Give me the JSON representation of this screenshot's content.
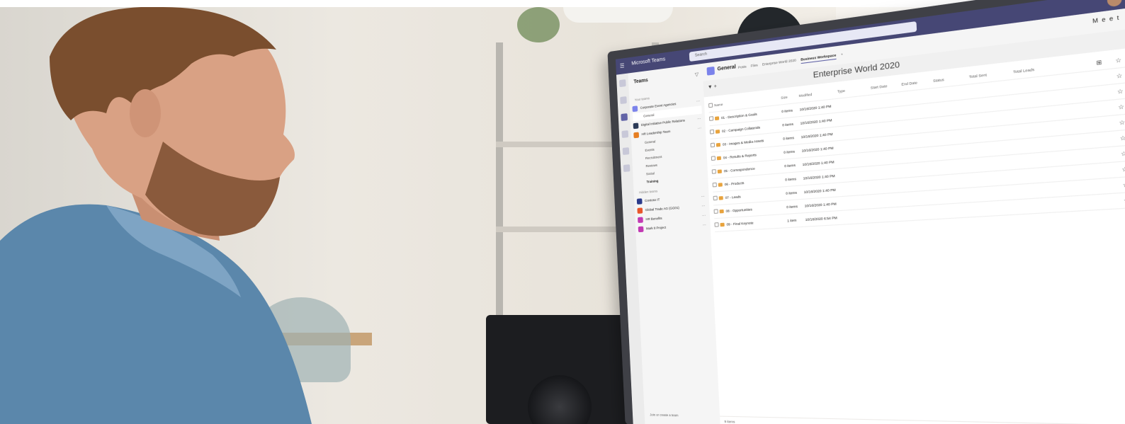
{
  "teams_app": {
    "title": "Microsoft Teams",
    "search_placeholder": "Search",
    "meet_button": "Meet",
    "teams_pane": {
      "title": "Teams",
      "your_teams_label": "Your teams",
      "hidden_teams_label": "Hidden teams",
      "teams": [
        {
          "name": "Corporate Event Agencies",
          "color": "#7b83eb",
          "channels": [
            {
              "name": "General",
              "selected": true
            }
          ]
        },
        {
          "name": "Digital Initiative Public Relations",
          "color": "#2b3a57",
          "channels": []
        },
        {
          "name": "HR Leadership Team",
          "color": "#e67e22",
          "channels": [
            {
              "name": "General"
            },
            {
              "name": "Events"
            },
            {
              "name": "Recruitment"
            },
            {
              "name": "Reviews"
            },
            {
              "name": "Social"
            },
            {
              "name": "Training",
              "bold": true
            }
          ]
        }
      ],
      "hidden_teams": [
        {
          "name": "Contoso IT",
          "color": "#2b3a8a"
        },
        {
          "name": "Global Trade AG (GG01)",
          "color": "#e8552b"
        },
        {
          "name": "HR Benefits",
          "color": "#c239b3"
        },
        {
          "name": "Mark 8 Project",
          "color": "#c239b3"
        }
      ],
      "join_link": "Join or create a team"
    },
    "channel": {
      "name": "General",
      "tabs": [
        "Posts",
        "Files",
        "Enterprise World 2020",
        "Business Workspace"
      ],
      "active_tab": "Business Workspace"
    },
    "list": {
      "title": "Enterprise World 2020",
      "columns": [
        "Name",
        "Size",
        "Modified",
        "Type",
        "Start Date",
        "End Date",
        "Status",
        "Total Sent",
        "Total Leads"
      ],
      "rows": [
        {
          "name": "01 - Description & Goals",
          "size": "0 items",
          "modified": "10/16/2020 1:40 PM"
        },
        {
          "name": "02 - Campaign Collaterals",
          "size": "0 items",
          "modified": "10/16/2020 1:40 PM"
        },
        {
          "name": "03 - Images & Media Assets",
          "size": "0 items",
          "modified": "10/16/2020 1:40 PM"
        },
        {
          "name": "04 - Results & Reports",
          "size": "0 items",
          "modified": "10/16/2020 1:40 PM"
        },
        {
          "name": "05 - Correspondence",
          "size": "0 items",
          "modified": "10/16/2020 1:40 PM"
        },
        {
          "name": "06 - Products",
          "size": "0 items",
          "modified": "10/16/2020 1:40 PM"
        },
        {
          "name": "07 - Leads",
          "size": "0 items",
          "modified": "10/16/2020 1:40 PM"
        },
        {
          "name": "08 - Opportunities",
          "size": "0 items",
          "modified": "10/16/2020 1:40 PM"
        },
        {
          "name": "09 - Final Keynote",
          "size": "1 item",
          "modified": "10/16/2020 6:54 PM"
        }
      ],
      "status_text": "9 items"
    }
  }
}
